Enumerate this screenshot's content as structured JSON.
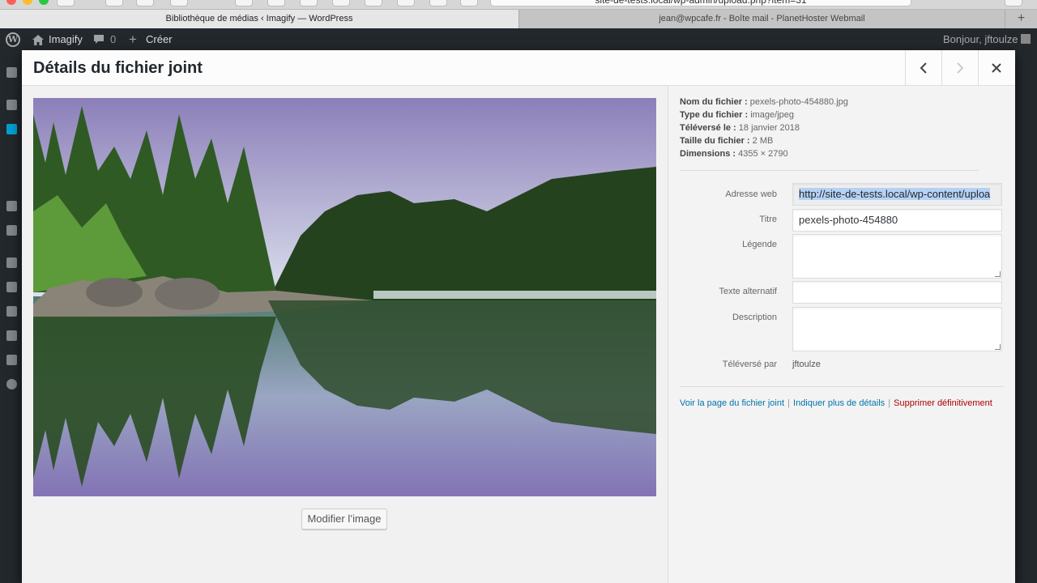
{
  "browser": {
    "url": "site-de-tests.local/wp-admin/upload.php?item=31",
    "tabs": [
      {
        "title": "Bibliothèque de médias ‹ Imagify — WordPress"
      },
      {
        "title": "jean@wpcafe.fr - Boîte mail - PlanetHoster Webmail"
      }
    ],
    "new_tab_icon": "plus-icon"
  },
  "admin_bar": {
    "site_name": "Imagify",
    "comments_count": "0",
    "new_label": "Créer",
    "greeting": "Bonjour, jftoulze"
  },
  "modal": {
    "title": "Détails du fichier joint",
    "prev_icon": "chevron-left-icon",
    "next_icon": "chevron-right-icon",
    "close_icon": "close-icon",
    "edit_image_label": "Modifier l’image"
  },
  "file_details": {
    "filename_label": "Nom du fichier :",
    "filename": "pexels-photo-454880.jpg",
    "filetype_label": "Type du fichier :",
    "filetype": "image/jpeg",
    "uploaded_label": "Téléversé le :",
    "uploaded": "18 janvier 2018",
    "filesize_label": "Taille du fichier :",
    "filesize": "2 MB",
    "dimensions_label": "Dimensions :",
    "dimensions": "4355 × 2790"
  },
  "settings": {
    "url_label": "Adresse web",
    "url_value": "http://site-de-tests.local/wp-content/uploa",
    "title_label": "Titre",
    "title_value": "pexels-photo-454880",
    "caption_label": "Légende",
    "caption_value": "",
    "alt_label": "Texte alternatif",
    "alt_value": "",
    "description_label": "Description",
    "description_value": "",
    "uploaded_by_label": "Téléversé par",
    "uploaded_by": "jftoulze"
  },
  "actions": {
    "view_page": "Voir la page du fichier joint",
    "more_details": "Indiquer plus de détails",
    "delete": "Supprimer définitivement"
  }
}
